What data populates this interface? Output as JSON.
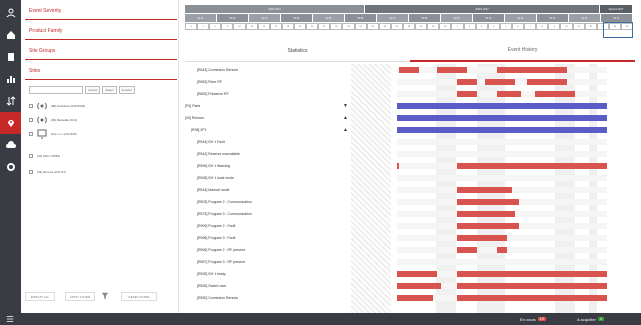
{
  "filter": {
    "headers": [
      "Event Severity",
      "Product Family",
      "Site Groups",
      "Sites"
    ],
    "search_placeholder": "",
    "search_buttons": [
      "Cancel",
      "Select",
      "Invertet"
    ],
    "tree": [
      {
        "label": "[08] Antartica (1140/1540)"
      },
      {
        "label": "[09] Marseille (0/11)"
      },
      {
        "label": "[11] L.L.L (211/228)"
      },
      {
        "label": "[44] Paris (78/89)"
      },
      {
        "label": "[43] Rennes (2/17/17)"
      }
    ],
    "footer": {
      "display_all": "DISPLAY ALL",
      "apply": "APPLY FILTER",
      "reset": "RESET FILTER"
    }
  },
  "timeline": {
    "months": [
      "JANV 2017",
      "AVRIL 2017",
      "Septem 2017"
    ],
    "weeks": [
      "W 01",
      "W 02",
      "W 03",
      "W 04",
      "W 05",
      "W 06",
      "W 07",
      "W 08",
      "W 09",
      "W 10",
      "W 11",
      "W 12",
      "W 13",
      "W 14"
    ],
    "days": [
      "9",
      "7",
      "1",
      "8",
      "15",
      "16",
      "13",
      "17",
      "18",
      "19",
      "20",
      "21",
      "22",
      "23",
      "24",
      "25",
      "26",
      "27",
      "28",
      "29",
      "30",
      "31",
      "1",
      "2",
      "3",
      "4",
      "5",
      "6",
      "7",
      "8",
      "9",
      "10",
      "11",
      "12",
      "13",
      "14",
      "15"
    ]
  },
  "tabs": {
    "statistics": "Statistics",
    "event_history": "Event History"
  },
  "rows": [
    {
      "label": "[R543] Connexion Rennes",
      "indent": 12,
      "bars": [
        [
          2,
          20
        ],
        [
          40,
          30
        ],
        [
          100,
          70
        ]
      ],
      "color": "#d9534f"
    },
    {
      "label": "[R653] Fibre RF",
      "indent": 12,
      "bars": [
        [
          60,
          20
        ],
        [
          88,
          30
        ],
        [
          130,
          40
        ]
      ],
      "color": "#d9534f"
    },
    {
      "label": "[R652] Présence RF",
      "indent": 12,
      "bars": [
        [
          60,
          20
        ],
        [
          100,
          24
        ],
        [
          138,
          40
        ]
      ],
      "color": "#d9534f"
    },
    {
      "label": "[P4] Paris",
      "indent": 0,
      "bars": [
        [
          0,
          210
        ]
      ],
      "color": "#5c5cc6",
      "arrow": "▼"
    },
    {
      "label": "[43] Rennes",
      "indent": 0,
      "bars": [
        [
          0,
          210
        ]
      ],
      "color": "#5c5cc6",
      "arrow": "▲"
    },
    {
      "label": "[R38] 2P1",
      "indent": 6,
      "bars": [
        [
          0,
          210
        ]
      ],
      "color": "#5c5cc6",
      "arrow": "▲"
    },
    {
      "label": "[R544] SH 1 Fault",
      "indent": 12,
      "bars": [],
      "color": "#d9534f"
    },
    {
      "label": "[R542] Reserve unavailable",
      "indent": 12,
      "bars": [],
      "color": "#d9534f"
    },
    {
      "label": "[R539] SH 1 Warning",
      "indent": 12,
      "bars": [
        [
          0,
          2
        ],
        [
          60,
          150
        ]
      ],
      "color": "#d9534f"
    },
    {
      "label": "[R528] SH 1 local mode",
      "indent": 12,
      "bars": [],
      "color": "#d9534f"
    },
    {
      "label": "[R514] Manual mode",
      "indent": 12,
      "bars": [
        [
          60,
          55
        ]
      ],
      "color": "#d9534f"
    },
    {
      "label": "[R503] Program 2 : Communication",
      "indent": 12,
      "bars": [
        [
          60,
          62
        ]
      ],
      "color": "#d9534f"
    },
    {
      "label": "[R573] Program 3 : Communication",
      "indent": 12,
      "bars": [
        [
          60,
          58
        ]
      ],
      "color": "#d9534f"
    },
    {
      "label": "[R909] Program 2 : Fault",
      "indent": 12,
      "bars": [
        [
          60,
          62
        ]
      ],
      "color": "#d9534f"
    },
    {
      "label": "[R908] Program 3 : Fault",
      "indent": 12,
      "bars": [
        [
          60,
          50
        ]
      ],
      "color": "#d9534f"
    },
    {
      "label": "[R506] Program 2 : RF present",
      "indent": 12,
      "bars": [
        [
          60,
          20
        ],
        [
          100,
          10
        ]
      ],
      "color": "#d9534f"
    },
    {
      "label": "[R567] Program 3 : RF present",
      "indent": 12,
      "bars": [],
      "color": "#d9534f"
    },
    {
      "label": "[R525] SH 1 ready",
      "indent": 12,
      "bars": [
        [
          0,
          40
        ],
        [
          60,
          150
        ]
      ],
      "color": "#d9534f"
    },
    {
      "label": "[R526] Switch over",
      "indent": 12,
      "bars": [
        [
          0,
          44
        ],
        [
          60,
          150
        ]
      ],
      "color": "#d9534f"
    },
    {
      "label": "[R530] Connexion Rennes",
      "indent": 12,
      "bars": [
        [
          0,
          36
        ],
        [
          60,
          150
        ]
      ],
      "color": "#d9534f"
    }
  ],
  "status": {
    "events_label": "En cours",
    "events_count": "19",
    "ack_label": "A acquitter",
    "ack_count": "4"
  }
}
